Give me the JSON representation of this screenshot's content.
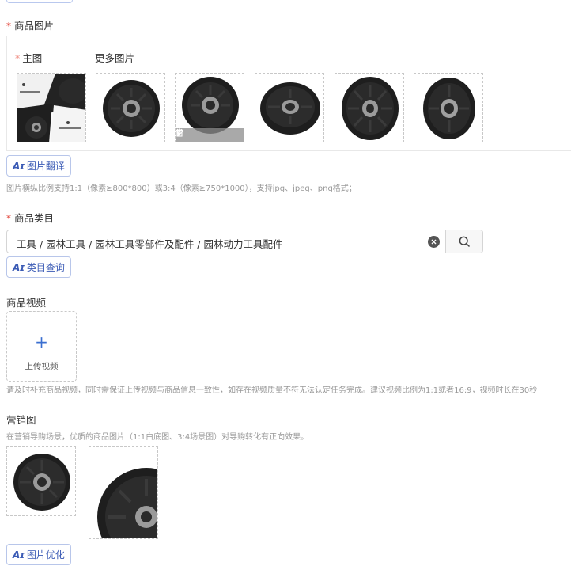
{
  "product_images": {
    "label": "商品图片",
    "main_label": "主图",
    "more_label": "更多图片",
    "thumbnails": [
      {
        "name": "main-image-collage"
      },
      {
        "name": "pulley-image-2"
      },
      {
        "name": "pulley-image-3"
      },
      {
        "name": "pulley-image-4"
      },
      {
        "name": "pulley-image-5"
      },
      {
        "name": "pulley-image-6"
      }
    ],
    "toolbar_icons": [
      "chevron-left-icon",
      "edit-icon",
      "delete-icon",
      "chevron-right-icon"
    ],
    "translate_button": "图片翻译",
    "hint": "图片横纵比例支持1:1（像素≥800*800）或3:4（像素≥750*1000），支持jpg、jpeg、png格式；"
  },
  "category": {
    "label": "商品类目",
    "value": "工具 / 园林工具 / 园林工具零部件及配件 / 园林动力工具配件",
    "query_button": "类目查询"
  },
  "video": {
    "label": "商品视频",
    "upload_label": "上传视频",
    "hint": "请及时补充商品视频，同时需保证上传视频与商品信息一致性，如存在视频质量不符无法认定任务完成。建议视频比例为1:1或者16:9，视频时长在30秒"
  },
  "marketing": {
    "label": "营销图",
    "hint": "在营销导购场景，优质的商品图片（1:1白底图、3:4场景图）对导购转化有正向效果。",
    "optimize_button": "图片优化"
  },
  "ai_mark": "Aɪ",
  "colors": {
    "required": "#e0362b",
    "accent": "#3b5bb5",
    "pulley": "#1e1e1e",
    "hub": "#9a9a9a"
  }
}
